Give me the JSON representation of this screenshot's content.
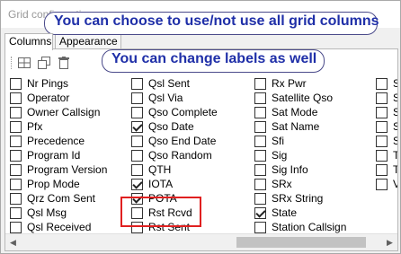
{
  "window": {
    "title": "Grid configuration"
  },
  "callouts": {
    "top": "You can choose to use/not use all grid columns",
    "middle": "You can change labels as well"
  },
  "tabs": [
    {
      "label": "Columns",
      "active": true
    },
    {
      "label": "Appearance",
      "active": false
    }
  ],
  "toolbar": {
    "icons": [
      "grid-layout-icon",
      "copy-icon",
      "delete-icon"
    ]
  },
  "columns": [
    [
      {
        "label": "Nr Pings",
        "checked": false
      },
      {
        "label": "Operator",
        "checked": false
      },
      {
        "label": "Owner Callsign",
        "checked": false
      },
      {
        "label": "Pfx",
        "checked": false
      },
      {
        "label": "Precedence",
        "checked": false
      },
      {
        "label": "Program Id",
        "checked": false
      },
      {
        "label": "Program Version",
        "checked": false
      },
      {
        "label": "Prop Mode",
        "checked": false
      },
      {
        "label": "Qrz Com Sent",
        "checked": false
      },
      {
        "label": "Qsl Msg",
        "checked": false
      },
      {
        "label": "Qsl Received",
        "checked": false
      }
    ],
    [
      {
        "label": "Qsl Sent",
        "checked": false
      },
      {
        "label": "Qsl Via",
        "checked": false
      },
      {
        "label": "Qso Complete",
        "checked": false
      },
      {
        "label": "Qso Date",
        "checked": true
      },
      {
        "label": "Qso End Date",
        "checked": false
      },
      {
        "label": "Qso Random",
        "checked": false
      },
      {
        "label": "QTH",
        "checked": false
      },
      {
        "label": "IOTA",
        "checked": true
      },
      {
        "label": "POTA",
        "checked": true
      },
      {
        "label": "Rst Rcvd",
        "checked": false
      },
      {
        "label": "Rst Sent",
        "checked": false
      }
    ],
    [
      {
        "label": "Rx Pwr",
        "checked": false
      },
      {
        "label": "Satellite Qso",
        "checked": false
      },
      {
        "label": "Sat Mode",
        "checked": false
      },
      {
        "label": "Sat Name",
        "checked": false
      },
      {
        "label": "Sfi",
        "checked": false
      },
      {
        "label": "Sig",
        "checked": false
      },
      {
        "label": "Sig Info",
        "checked": false
      },
      {
        "label": "SRx",
        "checked": false
      },
      {
        "label": "SRx String",
        "checked": false
      },
      {
        "label": "State",
        "checked": true
      },
      {
        "label": "Station Callsign",
        "checked": false
      }
    ],
    [
      {
        "label": "S",
        "checked": false
      },
      {
        "label": "S",
        "checked": false
      },
      {
        "label": "S",
        "checked": false
      },
      {
        "label": "S",
        "checked": false
      },
      {
        "label": "S",
        "checked": false
      },
      {
        "label": "T",
        "checked": false
      },
      {
        "label": "T",
        "checked": false
      },
      {
        "label": "V",
        "checked": false
      }
    ]
  ]
}
